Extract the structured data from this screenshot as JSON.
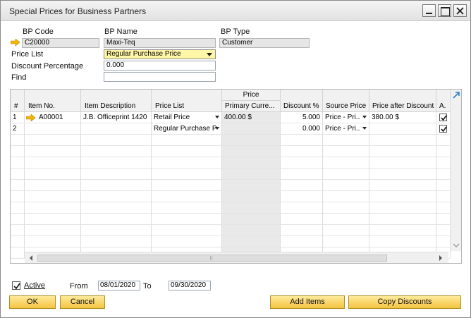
{
  "window": {
    "title": "Special Prices for Business Partners"
  },
  "header": {
    "bp_code_label": "BP Code",
    "bp_code_value": "C20000",
    "bp_name_label": "BP Name",
    "bp_name_value": "Maxi-Teq",
    "bp_type_label": "BP Type",
    "bp_type_value": "Customer",
    "price_list_label": "Price List",
    "price_list_value": "Regular Purchase Price",
    "discount_label": "Discount Percentage",
    "discount_value": "0.000",
    "find_label": "Find",
    "find_value": ""
  },
  "grid": {
    "group_header": "Price",
    "columns": [
      "#",
      "Item No.",
      "Item Description",
      "Price List",
      "Primary Curre...",
      "Discount %",
      "Source Price",
      "Price after Discount",
      "A."
    ],
    "rows": [
      {
        "num": "1",
        "item_no": "A00001",
        "description": "J.B. Officeprint 1420",
        "price_list": "Retail Price",
        "primary_price": "400.00 $",
        "discount": "5.000",
        "source_price": "Price - Pri..",
        "price_after": "380.00 $",
        "active": true
      },
      {
        "num": "2",
        "item_no": "",
        "description": "",
        "price_list": "Regular Purchase P",
        "primary_price": "",
        "discount": "0.000",
        "source_price": "Price - Pri..",
        "price_after": "",
        "active": true
      }
    ]
  },
  "footer": {
    "active_label": "Active",
    "active_checked": true,
    "from_label": "From",
    "from_value": "08/01/2020",
    "to_label": "To",
    "to_value": "09/30/2020"
  },
  "buttons": {
    "ok": "OK",
    "cancel": "Cancel",
    "add_items": "Add Items",
    "copy_discounts": "Copy Discounts"
  },
  "colors": {
    "accent": "#f4c542",
    "required_field": "#fff6a8",
    "arrow": "#f2b500"
  }
}
